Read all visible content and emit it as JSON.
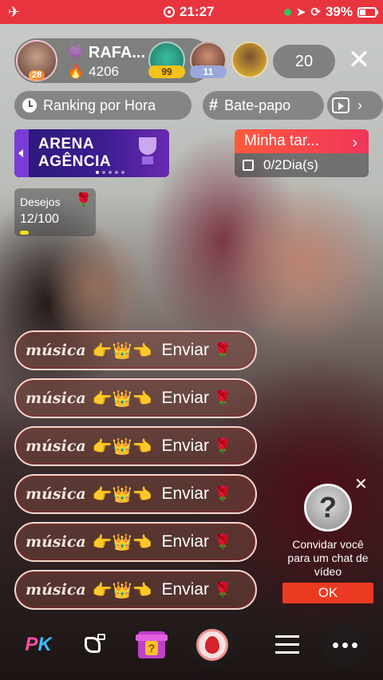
{
  "status_bar": {
    "time": "21:27",
    "battery": "39%",
    "battery_level": 0.39,
    "icons": [
      "airplane-icon",
      "record-icon",
      "location-icon",
      "orientation-lock-icon",
      "battery-charging-icon"
    ]
  },
  "host": {
    "name": "RAFA...",
    "level": "28",
    "score": "4206",
    "score_icon": "flame-icon"
  },
  "viewers": [
    {
      "badge": "99"
    },
    {
      "badge": "11"
    },
    {
      "badge": ""
    }
  ],
  "viewer_count": "20",
  "chips": {
    "ranking": "Ranking por Hora",
    "chat": "Bate-papo"
  },
  "arena": {
    "line1": "ARENA",
    "line2": "AGÊNCIA"
  },
  "task": {
    "title": "Minha tar...",
    "progress": "0/2Dia(s)"
  },
  "wishes": {
    "label": "Desejos",
    "count": "12/100",
    "progress": 0.12
  },
  "messages": [
    {
      "word": "música",
      "emojis": "👉👑👈",
      "send": "Enviar",
      "rose": "🌹"
    },
    {
      "word": "música",
      "emojis": "👉👑👈",
      "send": "Enviar",
      "rose": "🌹"
    },
    {
      "word": "música",
      "emojis": "👉👑👈",
      "send": "Enviar",
      "rose": "🌹"
    },
    {
      "word": "música",
      "emojis": "👉👑👈",
      "send": "Enviar",
      "rose": "🌹"
    },
    {
      "word": "música",
      "emojis": "👉👑👈",
      "send": "Enviar",
      "rose": "🌹"
    },
    {
      "word": "música",
      "emojis": "👉👑👈",
      "send": "Enviar",
      "rose": "🌹"
    }
  ],
  "invite": {
    "text": "Convidar você para um chat de vídeo",
    "ok": "OK"
  },
  "bottom": {
    "pk_p": "P",
    "pk_k": "K",
    "gift_mark": "?"
  },
  "colors": {
    "status_bar": "#e8343e",
    "task_header": "#ff5a3c",
    "ok_button": "#ec3a22",
    "arena_bg": "#3b1c8f"
  }
}
